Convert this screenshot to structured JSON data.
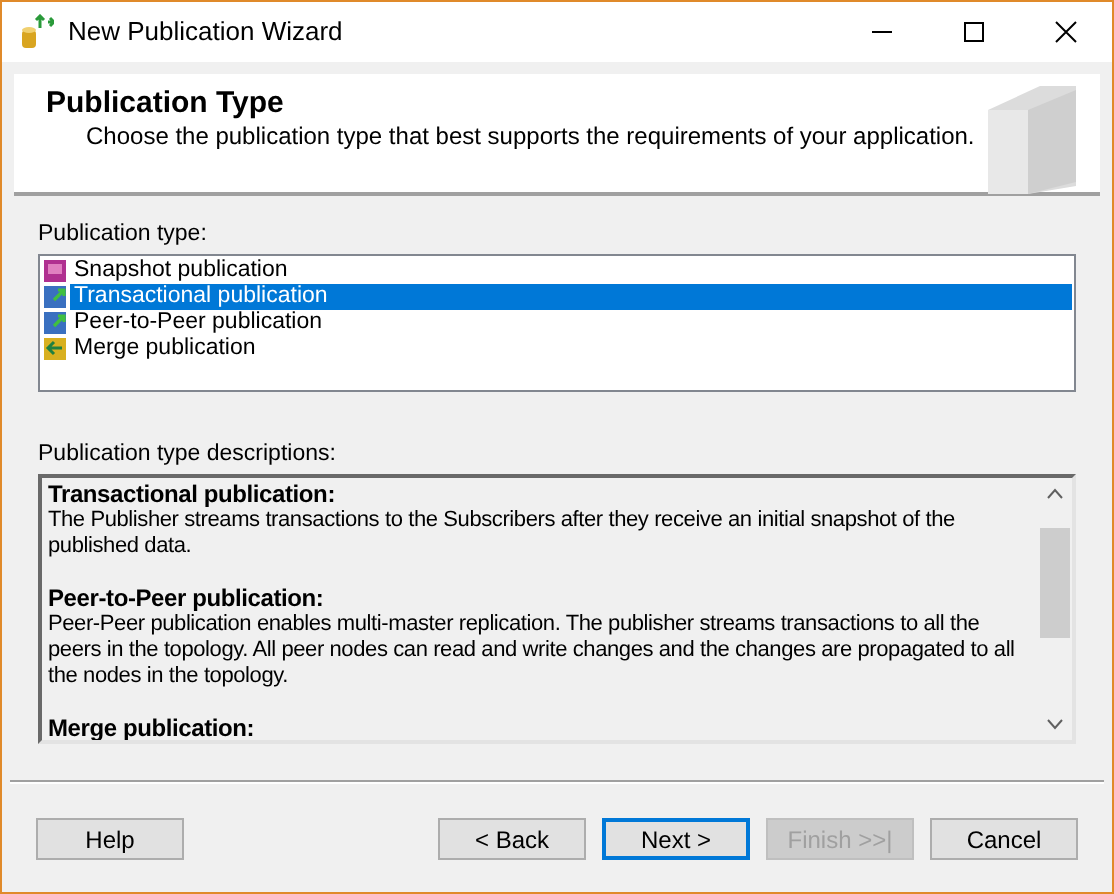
{
  "window": {
    "title": "New Publication Wizard"
  },
  "header": {
    "title": "Publication Type",
    "subtitle": "Choose the publication type that best supports the requirements of your application."
  },
  "publication_type": {
    "label": "Publication type:",
    "items": [
      {
        "label": "Snapshot publication",
        "kind": "snapshot",
        "selected": false
      },
      {
        "label": "Transactional publication",
        "kind": "transactional",
        "selected": true
      },
      {
        "label": "Peer-to-Peer publication",
        "kind": "peer",
        "selected": false
      },
      {
        "label": "Merge publication",
        "kind": "merge",
        "selected": false
      }
    ]
  },
  "descriptions": {
    "label": "Publication type descriptions:",
    "sections": [
      {
        "title": "Transactional publication:",
        "text": "The Publisher streams transactions to the Subscribers after they receive an initial snapshot of the published data."
      },
      {
        "title": "Peer-to-Peer publication:",
        "text": "Peer-Peer publication enables multi-master replication. The publisher streams transactions to all the peers in the topology. All peer nodes can read and write changes and the changes are propagated to all the nodes in the topology."
      },
      {
        "title": "Merge publication:"
      }
    ]
  },
  "buttons": [
    {
      "label": "Help",
      "disabled": false,
      "focused": false
    },
    {
      "label": "< Back",
      "disabled": false,
      "focused": false
    },
    {
      "label": "Next >",
      "disabled": false,
      "focused": true
    },
    {
      "label": "Finish >>|",
      "disabled": true,
      "focused": false
    },
    {
      "label": "Cancel",
      "disabled": false,
      "focused": false
    }
  ]
}
